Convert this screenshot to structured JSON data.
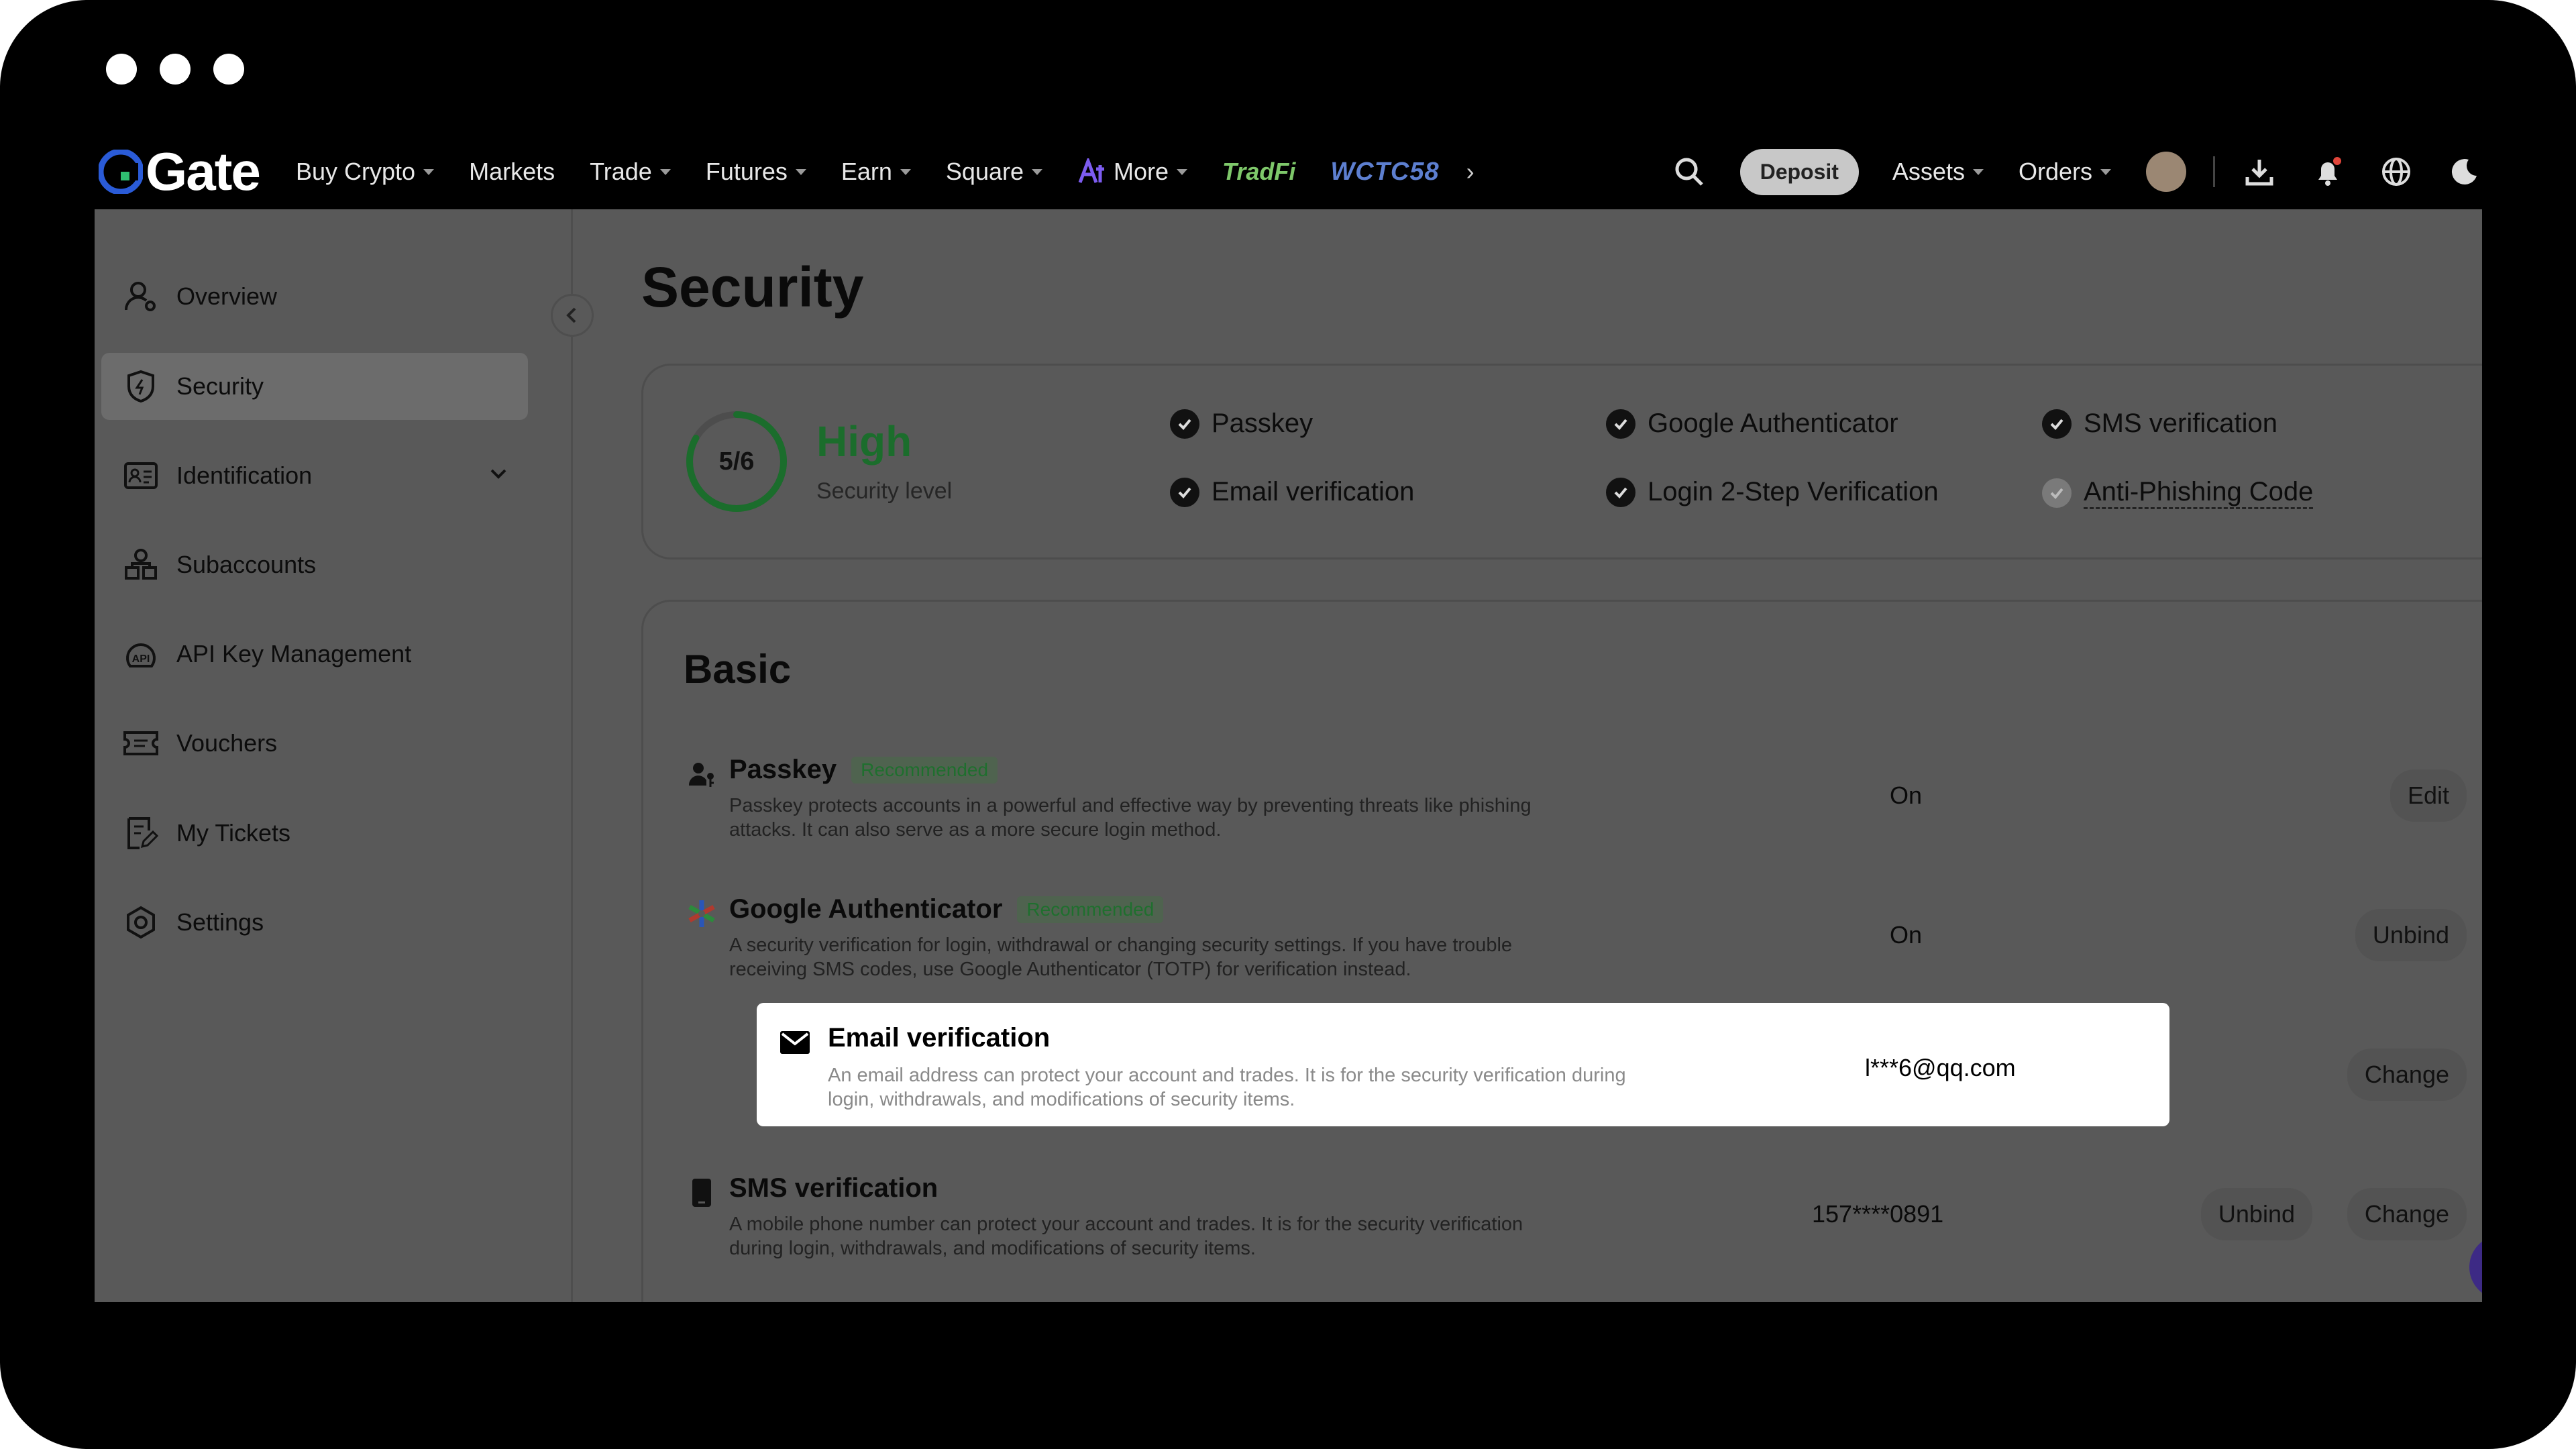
{
  "brand": {
    "name": "Gate"
  },
  "nav": {
    "items": [
      {
        "label": "Buy Crypto",
        "dropdown": true
      },
      {
        "label": "Markets",
        "dropdown": false
      },
      {
        "label": "Trade",
        "dropdown": true
      },
      {
        "label": "Futures",
        "dropdown": true
      },
      {
        "label": "Earn",
        "dropdown": true
      },
      {
        "label": "Square",
        "dropdown": true
      },
      {
        "label": "More",
        "dropdown": true
      }
    ],
    "tradfi": "TradFi",
    "wctc": "WCTC58",
    "deposit": "Deposit",
    "assets": "Assets",
    "orders": "Orders"
  },
  "sidebar": {
    "items": [
      {
        "label": "Overview",
        "icon": "user-icon"
      },
      {
        "label": "Security",
        "icon": "shield-icon",
        "active": true
      },
      {
        "label": "Identification",
        "icon": "id-card-icon"
      },
      {
        "label": "Subaccounts",
        "icon": "subaccounts-icon"
      },
      {
        "label": "API Key Management",
        "icon": "api-icon"
      },
      {
        "label": "Vouchers",
        "icon": "voucher-icon"
      },
      {
        "label": "My Tickets",
        "icon": "ticket-icon"
      },
      {
        "label": "Settings",
        "icon": "settings-icon"
      }
    ]
  },
  "page": {
    "title": "Security",
    "summary": {
      "score": "5/6",
      "score_fraction": 0.833,
      "level": "High",
      "level_label": "Security level",
      "checks": [
        {
          "label": "Passkey",
          "done": true
        },
        {
          "label": "Google Authenticator",
          "done": true
        },
        {
          "label": "SMS verification",
          "done": true
        },
        {
          "label": "Email verification",
          "done": true
        },
        {
          "label": "Login 2-Step Verification",
          "done": true
        },
        {
          "label": "Anti-Phishing Code",
          "done": false
        }
      ]
    },
    "basic": {
      "title": "Basic",
      "rows": [
        {
          "title": "Passkey",
          "tag": "Recommended",
          "desc": "Passkey protects accounts in a powerful and effective way by preventing threats like phishing attacks. It can also serve as a more secure login method.",
          "status": "On",
          "buttons": [
            "Edit"
          ]
        },
        {
          "title": "Google Authenticator",
          "tag": "Recommended",
          "desc": "A security verification for login, withdrawal or changing security settings. If you have trouble receiving SMS codes, use Google Authenticator (TOTP) for verification instead.",
          "status": "On",
          "buttons": [
            "Unbind"
          ]
        },
        {
          "title": "Email verification",
          "tag": "",
          "desc": "An email address can protect your account and trades. It is for the security verification during login, withdrawals, and modifications of security items.",
          "status": "l***6@qq.com",
          "buttons": [
            "Change"
          ]
        },
        {
          "title": "SMS verification",
          "tag": "",
          "desc": "A mobile phone number can protect your account and trades. It is for the security verification during login, withdrawals, and modifications of security items.",
          "status": "157****0891",
          "buttons": [
            "Unbind",
            "Change"
          ]
        }
      ]
    }
  },
  "colors": {
    "accent": "#1b6d2c",
    "overlay": "#595959",
    "highlight": "#ffffff"
  }
}
